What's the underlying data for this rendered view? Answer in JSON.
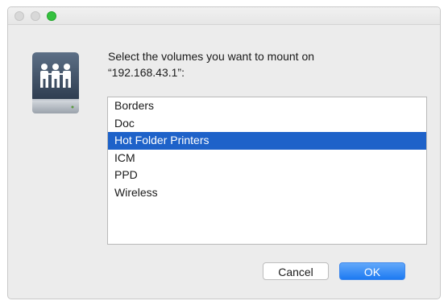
{
  "window": {
    "title": ""
  },
  "dialog": {
    "prompt_line1": "Select the volumes you want to mount on",
    "prompt_line2": "“192.168.43.1”:",
    "icon": "shared-server-drive-icon",
    "volumes": [
      {
        "label": "Borders",
        "selected": false
      },
      {
        "label": "Doc",
        "selected": false
      },
      {
        "label": "Hot Folder Printers",
        "selected": true
      },
      {
        "label": "ICM",
        "selected": false
      },
      {
        "label": "PPD",
        "selected": false
      },
      {
        "label": "Wireless",
        "selected": false
      }
    ],
    "cancel_label": "Cancel",
    "ok_label": "OK"
  },
  "colors": {
    "selection": "#1e62c9",
    "ok_button": "#1d7af2",
    "zoom_button": "#35c13f"
  }
}
